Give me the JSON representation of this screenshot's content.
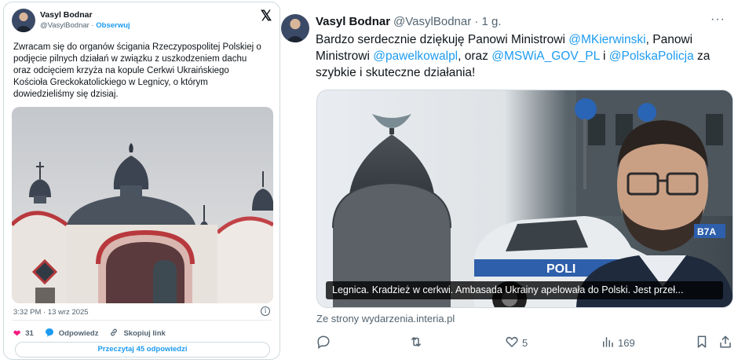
{
  "left_card": {
    "author_name": "Vasyl Bodnar",
    "author_handle": "@VasylBodnar",
    "separator": "·",
    "follow_label": "Obserwuj",
    "text": "Zwracam się do organów ścigania Rzeczypospolitej Polskiej o podjęcie pilnych działań w związku z uszkodzeniem dachu oraz odcięciem krzyża na kopule Cerkwi Ukraińskiego Kościoła Greckokatolickiego w Legnicy, o którym dowiedzieliśmy się dzisiaj.",
    "timestamp": "3:32 PM · 13 wrz 2025",
    "likes": "31",
    "reply_label": "Odpowiedz",
    "copy_link_label": "Skopiuj link",
    "read_replies_label": "Przeczytaj 45 odpowiedzi"
  },
  "right_tweet": {
    "author_name": "Vasyl Bodnar",
    "author_handle": "@VasylBodnar · 1 g.",
    "text_parts": {
      "p1": "Bardzo serdecznie dziękuję Panowi Ministrowi ",
      "m1": "@MKierwinski",
      "p2": ", Panowi Ministrowi ",
      "m2": "@pawelkowalpl",
      "p3": ", oraz ",
      "m3": "@MSWiA_GOV_PL",
      "p4": " i ",
      "m4": "@PolskaPolicja",
      "p5": " za szybkie i skuteczne działania!"
    },
    "media_caption": "Legnica. Kradzież w cerkwi. Ambasada Ukrainy apelowała do Polski. Jest przeł...",
    "source": "Ze strony wydarzenia.interia.pl",
    "likes": "5",
    "views": "169"
  },
  "colors": {
    "accent": "#1d9bf0",
    "text": "#0f1419",
    "muted": "#536471",
    "like": "#f91880"
  },
  "icons": [
    "x-logo-icon",
    "info-icon",
    "heart-icon",
    "reply-icon",
    "link-icon",
    "more-icon",
    "retweet-icon",
    "views-icon",
    "bookmark-icon",
    "share-icon"
  ]
}
